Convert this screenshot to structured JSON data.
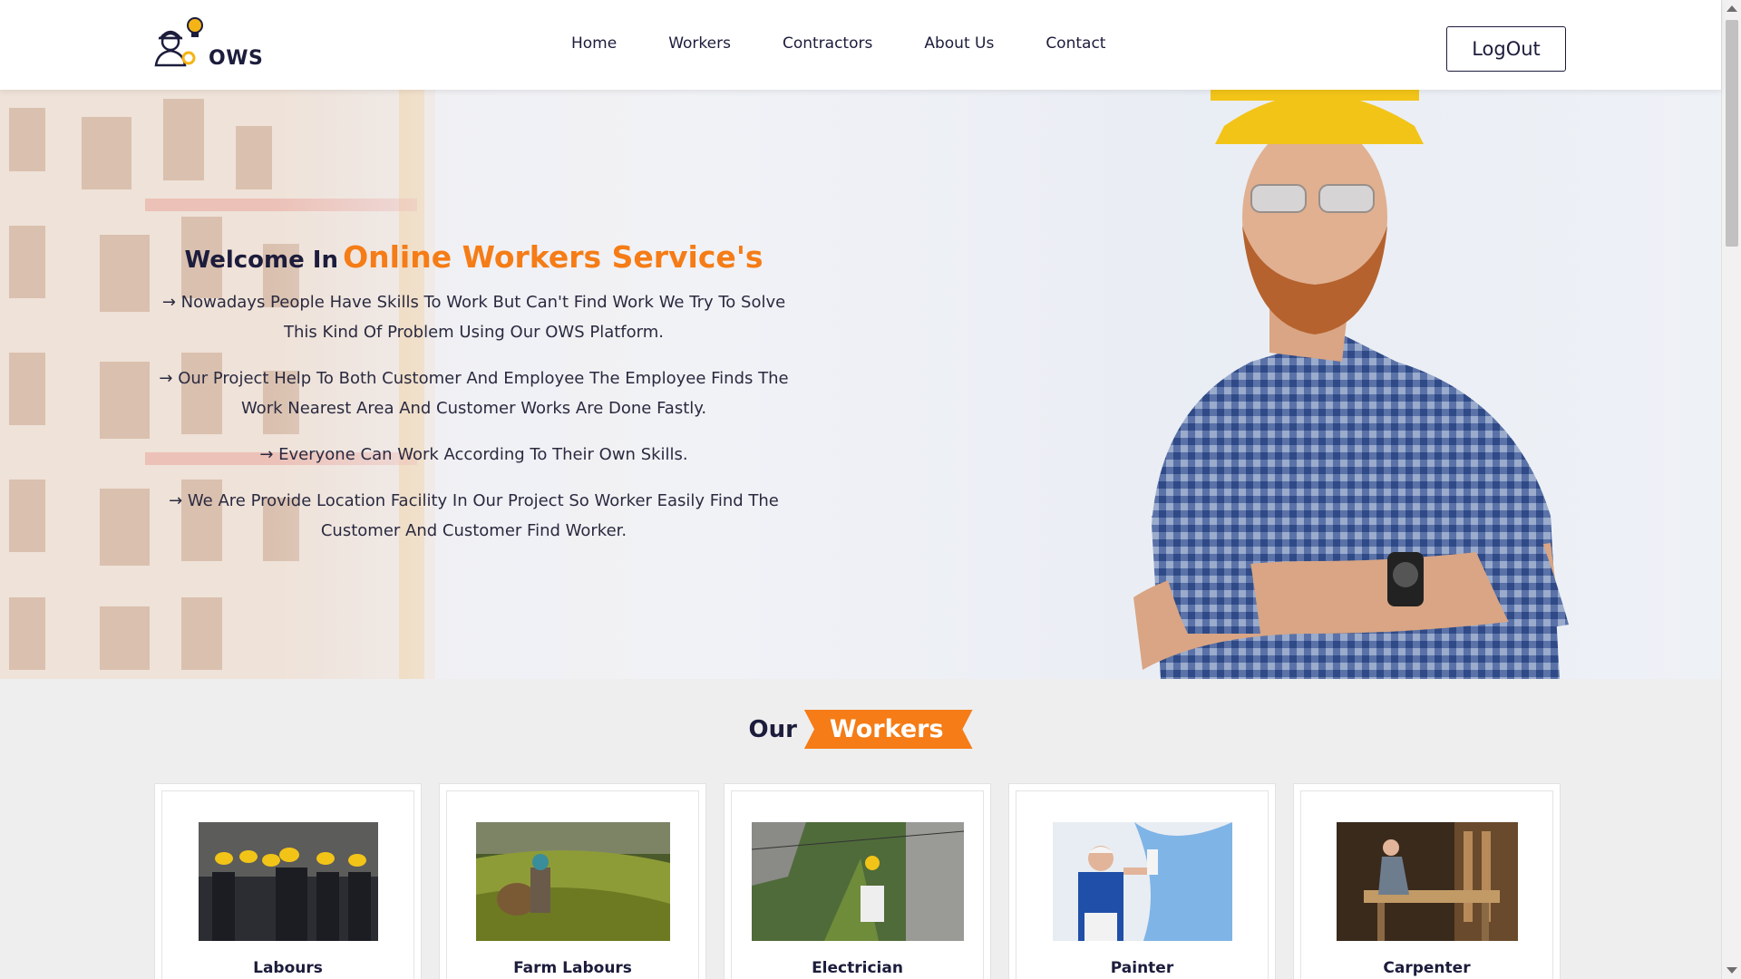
{
  "header": {
    "logo_text": "OWS",
    "nav": [
      "Home",
      "Workers",
      "Contractors",
      "About Us",
      "Contact"
    ],
    "logout_label": "LogOut"
  },
  "hero": {
    "title_part1": "Welcome In",
    "title_part2": "Online Workers Service's",
    "paragraphs": [
      "→ Nowadays People Have Skills To Work But Can't Find Work We Try To Solve This Kind Of Problem Using Our OWS Platform.",
      "→ Our Project Help To Both Customer And Employee The Employee Finds The Work Nearest Area And Customer Works Are Done Fastly.",
      "→ Everyone Can Work According To Their Own Skills.",
      "→ We Are Provide Location Facility In Our Project So Worker Easily Find The Customer And Customer Find Worker."
    ]
  },
  "workers_section": {
    "title_part1": "Our",
    "title_part2": "Workers",
    "cards": [
      {
        "label": "Labours",
        "image_icon": "labours-photo"
      },
      {
        "label": "Farm Labours",
        "image_icon": "farm-labours-photo"
      },
      {
        "label": "Electrician",
        "image_icon": "electrician-photo"
      },
      {
        "label": "Painter",
        "image_icon": "painter-photo"
      },
      {
        "label": "Carpenter",
        "image_icon": "carpenter-photo"
      }
    ]
  },
  "colors": {
    "accent": "#f57c16",
    "dark": "#1c1c3c",
    "background": "#eeeeee"
  }
}
